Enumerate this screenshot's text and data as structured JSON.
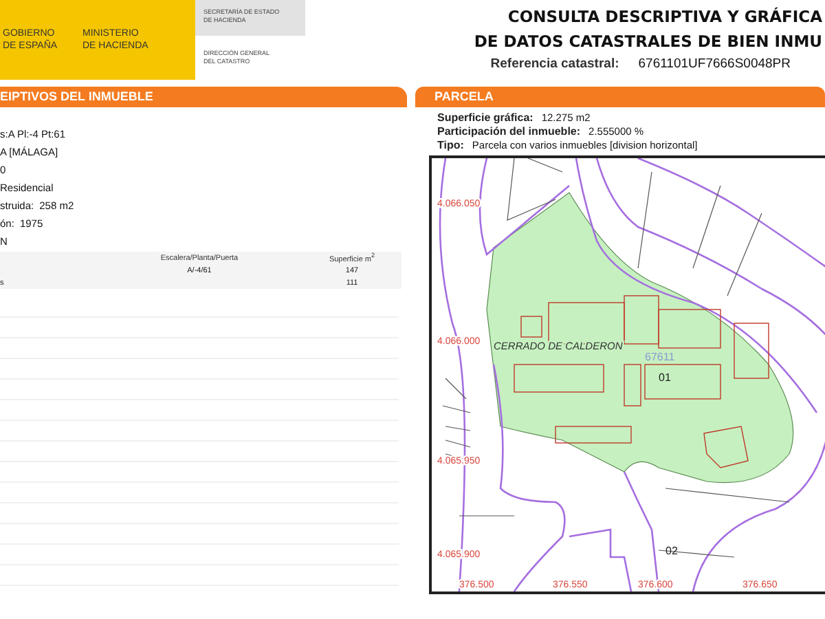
{
  "header": {
    "logo_left": [
      "GOBIERNO",
      "DE ESPAÑA"
    ],
    "logo_right": [
      "MINISTERIO",
      "DE HACIENDA"
    ],
    "secretaria": [
      "SECRETARÍA DE ESTADO",
      "DE HACIENDA"
    ],
    "direccion": [
      "DIRECCIÓN GENERAL",
      "DEL CATASTRO"
    ],
    "title": [
      "CONSULTA DESCRIPTIVA Y GRÁFICA",
      "DE DATOS CATASTRALES DE BIEN INMU"
    ],
    "ref_label": "Referencia catastral:",
    "ref_value": "6761101UF7666S0048PR"
  },
  "left": {
    "heading": "EIPTIVOS DEL INMUEBLE",
    "fields": [
      {
        "value": "s:A Pl:-4 Pt:61"
      },
      {
        "value": "A [MÁLAGA]"
      },
      {
        "value": "0"
      },
      {
        "value": "Residencial"
      },
      {
        "label": "struida:",
        "value": "258 m2"
      },
      {
        "label": "ón:",
        "value": "1975"
      }
    ],
    "subheading": "N",
    "table": {
      "columns": [
        "",
        "Escalera/Planta/Puerta",
        "Superficie m$^{2}$"
      ],
      "rows": [
        [
          "",
          "A/-4/61",
          "147"
        ],
        [
          "s",
          "",
          "111"
        ]
      ]
    }
  },
  "right": {
    "heading": "PARCELA",
    "fields": [
      {
        "label": "Superficie gráfica:",
        "value": "12.275 m2"
      },
      {
        "label": "Participación del inmueble:",
        "value": "2.555000 %"
      },
      {
        "label": "Tipo:",
        "value": "Parcela con varios inmuebles [division horizontal]"
      }
    ],
    "map": {
      "y_coords": [
        "4.066.050",
        "4.066.000",
        "4.065.950",
        "4.065.900"
      ],
      "x_coords": [
        "376.500",
        "376.550",
        "376.600",
        "376.650"
      ],
      "street": "CERRADO DE CALDERON",
      "parcel": "67611",
      "subparcels": [
        "01",
        "02"
      ]
    }
  }
}
